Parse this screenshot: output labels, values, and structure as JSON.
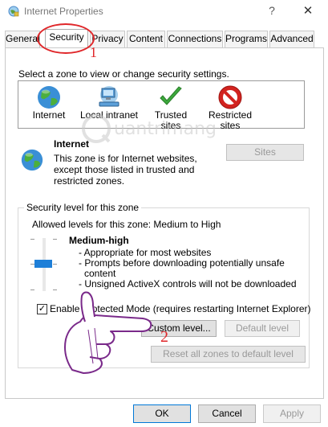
{
  "window": {
    "title": "Internet Properties",
    "help_glyph": "?",
    "close_glyph": "✕"
  },
  "tabs": [
    {
      "label": "General",
      "active": false
    },
    {
      "label": "Security",
      "active": true
    },
    {
      "label": "Privacy",
      "active": false
    },
    {
      "label": "Content",
      "active": false
    },
    {
      "label": "Connections",
      "active": false
    },
    {
      "label": "Programs",
      "active": false
    },
    {
      "label": "Advanced",
      "active": false
    }
  ],
  "annotations": {
    "step1": "1",
    "step2": "2",
    "color": "#e0272a"
  },
  "security": {
    "select_zone_label": "Select a zone to view or change security settings.",
    "zones": [
      {
        "label": "Internet",
        "icon": "globe-icon"
      },
      {
        "label": "Local intranet",
        "icon": "network-computer-icon"
      },
      {
        "label": "Trusted sites",
        "icon": "checkmark-icon"
      },
      {
        "label": "Restricted sites",
        "icon": "no-entry-icon"
      }
    ],
    "selected_zone": {
      "name": "Internet",
      "description": "This zone is for Internet websites, except those listed in trusted and restricted zones.",
      "sites_button": "Sites"
    },
    "level_group": {
      "legend": "Security level for this zone",
      "allowed": "Allowed levels for this zone: Medium to High",
      "level_name": "Medium-high",
      "level_points": [
        "- Appropriate for most websites",
        "- Prompts before downloading potentially unsafe",
        "  content",
        "- Unsigned ActiveX controls will not be downloaded"
      ],
      "protected_mode_label": "Enable Protected Mode (requires restarting Internet Explorer)",
      "protected_mode_checked": true,
      "custom_level_button": "Custom level...",
      "default_level_button": "Default level",
      "reset_all_button": "Reset all zones to default level"
    }
  },
  "footer": {
    "ok": "OK",
    "cancel": "Cancel",
    "apply": "Apply"
  },
  "watermark": {
    "text": "uantrimang"
  },
  "colors": {
    "accent": "#0078d7",
    "slider_thumb": "#1e7fd8",
    "check_green": "#3ca83c",
    "restricted_red": "#d2231f"
  }
}
